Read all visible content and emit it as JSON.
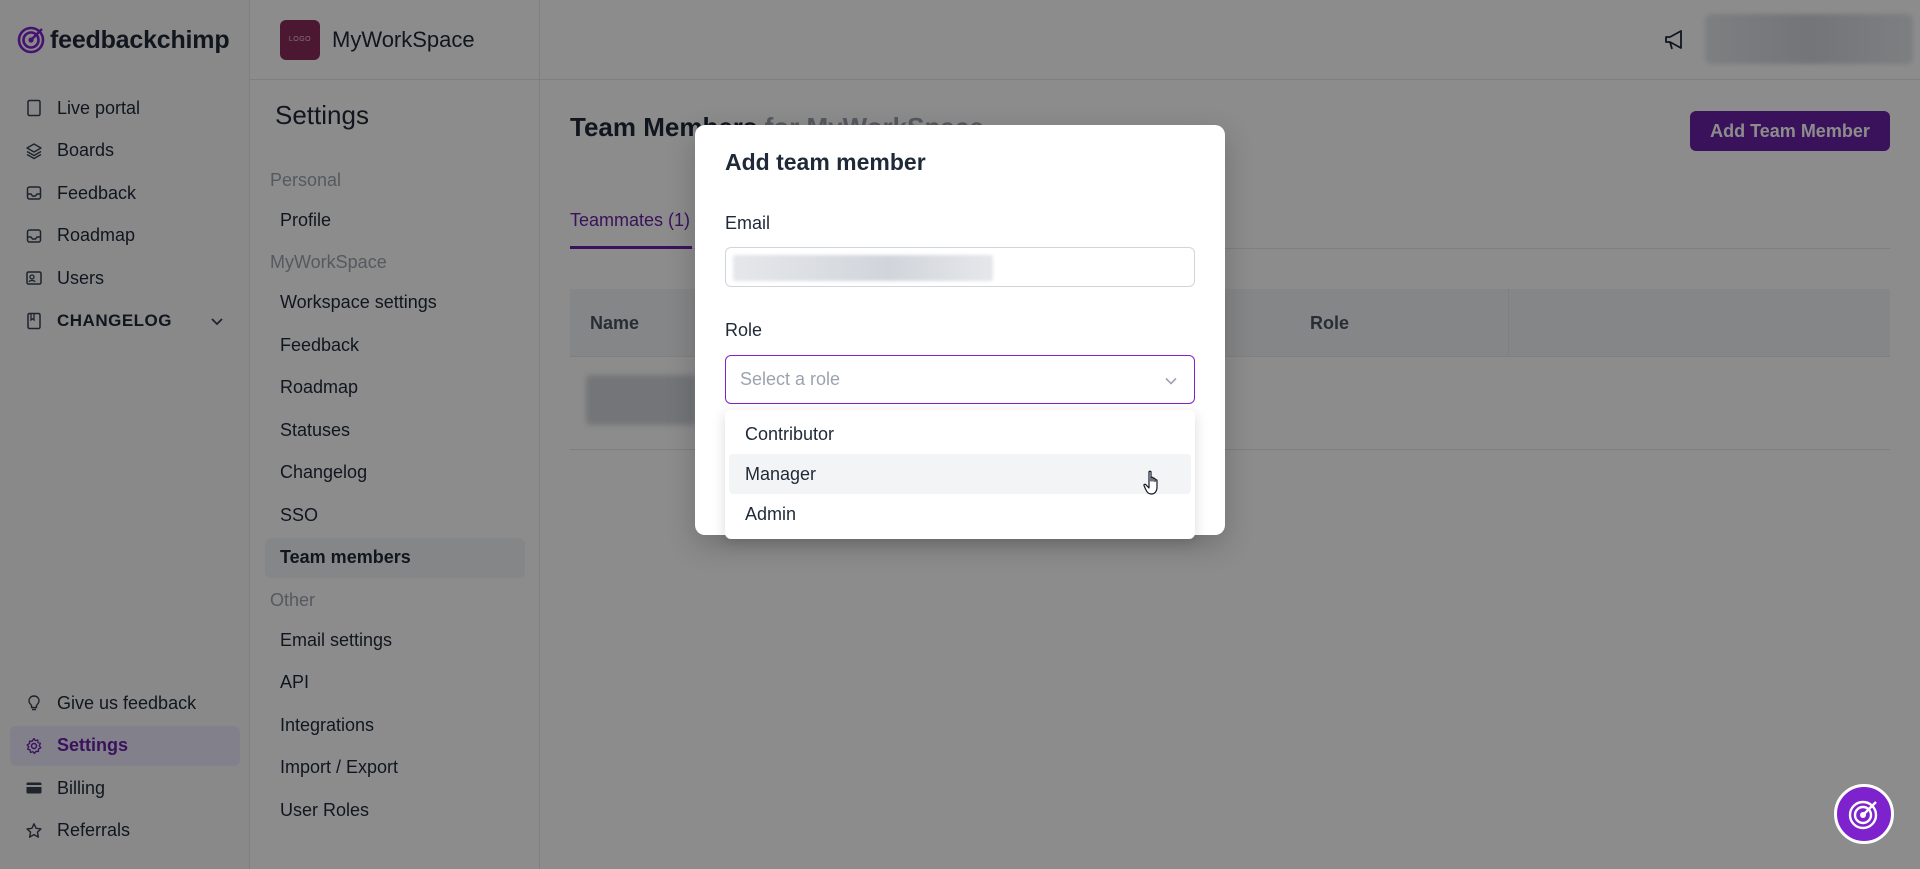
{
  "brand": {
    "name": "feedbackchimp"
  },
  "nav": {
    "items": [
      {
        "label": "Live portal",
        "icon": "file-icon"
      },
      {
        "label": "Boards",
        "icon": "boards-icon"
      },
      {
        "label": "Feedback",
        "icon": "inbox-icon"
      },
      {
        "label": "Roadmap",
        "icon": "roadmap-icon"
      },
      {
        "label": "Users",
        "icon": "users-icon"
      },
      {
        "label": "CHANGELOG",
        "icon": "book-icon"
      }
    ],
    "bottom": [
      {
        "label": "Give us feedback",
        "icon": "lightbulb-icon"
      },
      {
        "label": "Settings",
        "icon": "gear-icon"
      },
      {
        "label": "Billing",
        "icon": "card-icon"
      },
      {
        "label": "Referrals",
        "icon": "star-icon"
      }
    ]
  },
  "workspace": {
    "name": "MyWorkSpace",
    "logo_text": "LOGO"
  },
  "settings": {
    "title": "Settings",
    "group_personal": "Personal",
    "profile": "Profile",
    "group_workspace": "MyWorkSpace",
    "workspace_items": [
      "Workspace settings",
      "Feedback",
      "Roadmap",
      "Statuses",
      "Changelog",
      "SSO",
      "Team members"
    ],
    "group_other": "Other",
    "other_items": [
      "Email settings",
      "API",
      "Integrations",
      "Import / Export",
      "User Roles"
    ]
  },
  "main": {
    "title": "Team Members",
    "title_suffix": "for MyWorkSpace",
    "add_button": "Add Team Member",
    "tab": "Teammates (1)",
    "columns": {
      "name": "Name",
      "role": "Role"
    }
  },
  "modal": {
    "title": "Add team member",
    "email_label": "Email",
    "role_label": "Role",
    "role_placeholder": "Select a role",
    "options": [
      "Contributor",
      "Manager",
      "Admin"
    ],
    "hovered_option": "Manager"
  },
  "colors": {
    "accent": "#6b21a8",
    "overlay": "rgba(0,0,0,0.45)"
  }
}
